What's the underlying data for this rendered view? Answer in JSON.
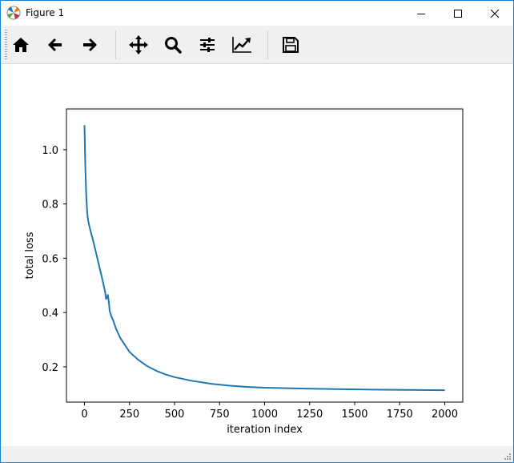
{
  "window": {
    "title": "Figure 1"
  },
  "toolbar": {
    "buttons": [
      {
        "name": "home-button",
        "icon": "home-icon"
      },
      {
        "name": "back-button",
        "icon": "arrow-left-icon"
      },
      {
        "name": "forward-button",
        "icon": "arrow-right-icon"
      },
      {
        "name": "pan-button",
        "icon": "move-icon"
      },
      {
        "name": "zoom-button",
        "icon": "magnifier-icon"
      },
      {
        "name": "configure-subplots-button",
        "icon": "sliders-icon"
      },
      {
        "name": "edit-axes-button",
        "icon": "line-chart-icon"
      },
      {
        "name": "save-button",
        "icon": "floppy-disk-icon"
      }
    ]
  },
  "chart_data": {
    "type": "line",
    "title": "",
    "xlabel": "iteration index",
    "ylabel": "total loss",
    "xlim": [
      -100,
      2100
    ],
    "ylim": [
      0.07,
      1.15
    ],
    "xticks": [
      0,
      250,
      500,
      750,
      1000,
      1250,
      1500,
      1750,
      2000
    ],
    "yticks": [
      0.2,
      0.4,
      0.6,
      0.8,
      1.0
    ],
    "xtick_labels": [
      "0",
      "250",
      "500",
      "750",
      "1000",
      "1250",
      "1500",
      "1750",
      "2000"
    ],
    "ytick_labels": [
      "0.2",
      "0.4",
      "0.6",
      "0.8",
      "1.0"
    ],
    "grid": false,
    "color": "#1f77b4",
    "series": [
      {
        "x": [
          0,
          5,
          10,
          15,
          20,
          30,
          50,
          75,
          100,
          115,
          120,
          125,
          130,
          135,
          140,
          150,
          160,
          175,
          200,
          250,
          300,
          350,
          400,
          450,
          500,
          600,
          700,
          800,
          900,
          1000,
          1200,
          1400,
          1600,
          1800,
          2000
        ],
        "y": [
          1.09,
          0.93,
          0.83,
          0.77,
          0.74,
          0.71,
          0.66,
          0.59,
          0.52,
          0.475,
          0.45,
          0.455,
          0.465,
          0.44,
          0.405,
          0.385,
          0.37,
          0.34,
          0.305,
          0.255,
          0.225,
          0.202,
          0.185,
          0.172,
          0.162,
          0.148,
          0.138,
          0.131,
          0.126,
          0.123,
          0.12,
          0.118,
          0.116,
          0.115,
          0.114
        ]
      }
    ]
  }
}
